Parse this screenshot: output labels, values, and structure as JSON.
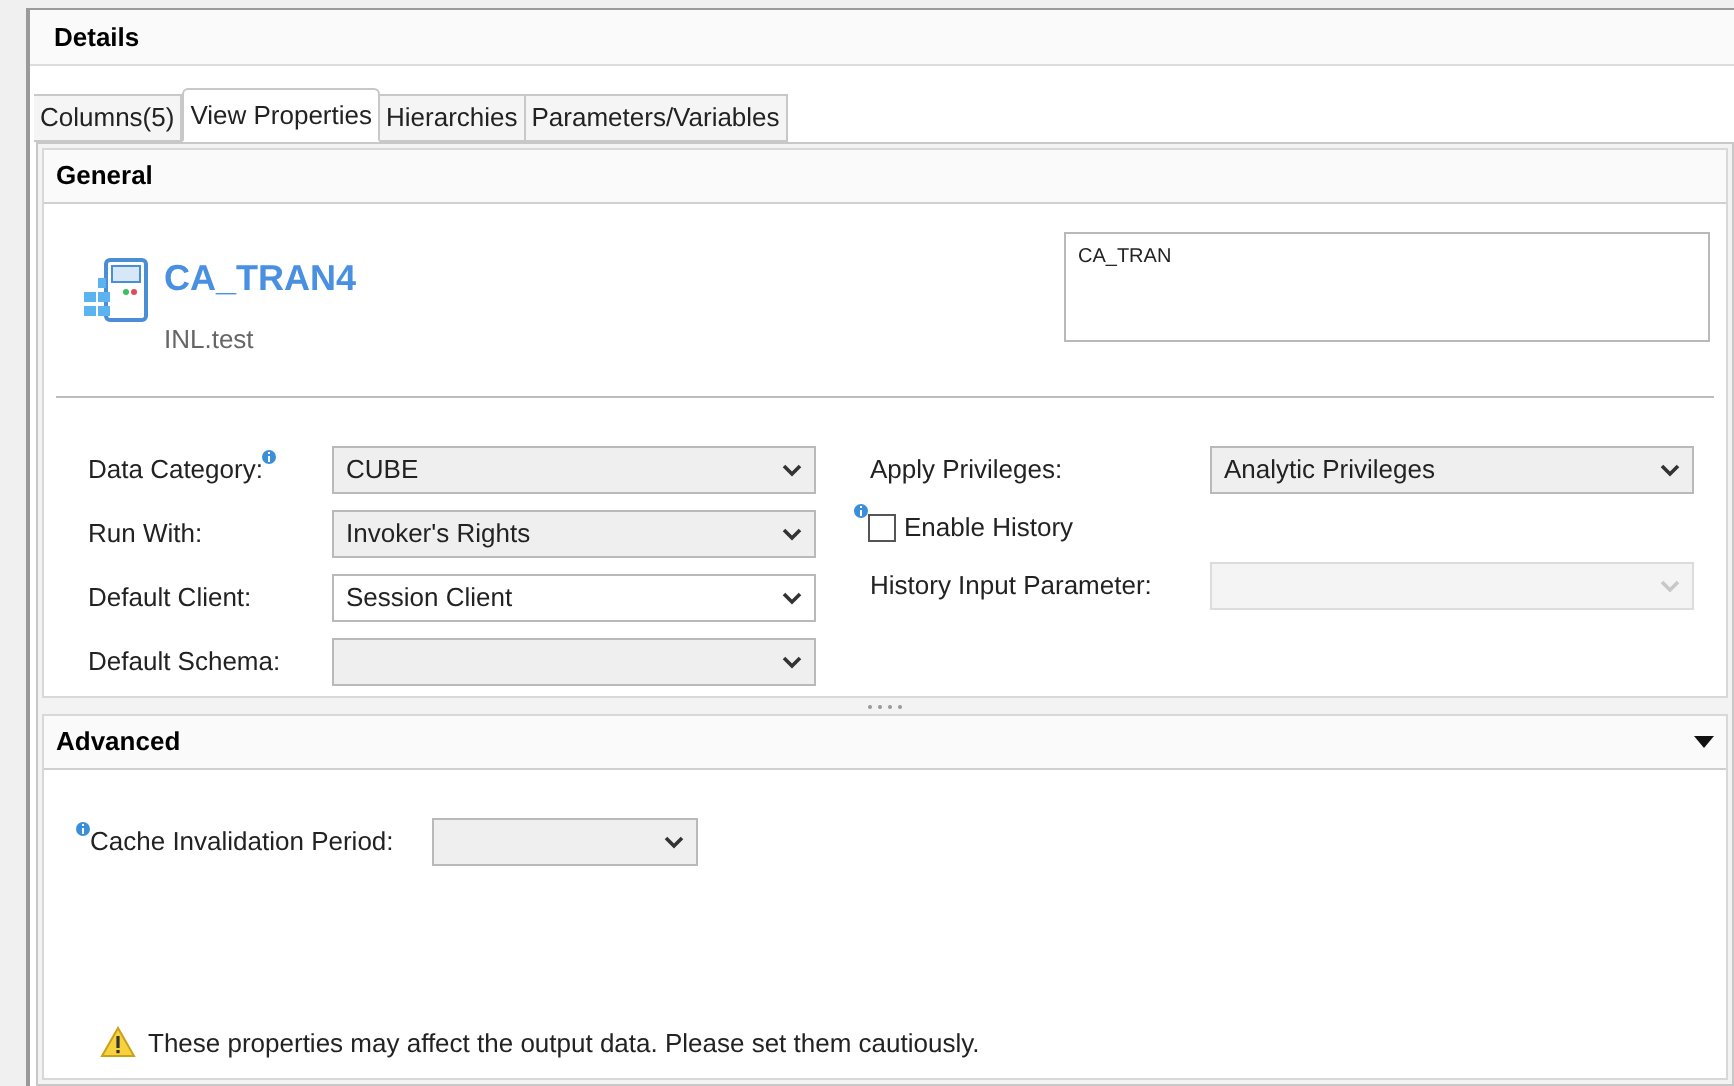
{
  "panel": {
    "title": "Details"
  },
  "tabs": [
    {
      "label": "Columns(5)",
      "selected": false
    },
    {
      "label": "View Properties",
      "selected": true
    },
    {
      "label": "Hierarchies",
      "selected": false
    },
    {
      "label": "Parameters/Variables",
      "selected": false
    }
  ],
  "general": {
    "title": "General",
    "object_name": "CA_TRAN4",
    "package": "INL.test",
    "description": "CA_TRAN",
    "left_fields": [
      {
        "label": "Data Category:",
        "value": "CUBE",
        "kind": "dropdown",
        "disabled": false,
        "info_after": true
      },
      {
        "label": "Run With:",
        "value": "Invoker's Rights",
        "kind": "dropdown",
        "disabled": false
      },
      {
        "label": "Default Client:",
        "value": "Session Client",
        "kind": "combo",
        "disabled": false
      },
      {
        "label": "Default Schema:",
        "kind": "dropdown",
        "disabled": false
      }
    ],
    "right_fields": [
      {
        "label": "Apply Privileges:",
        "value": "Analytic Privileges",
        "kind": "dropdown",
        "disabled": false
      },
      {
        "label": "Enable History",
        "kind": "checkbox",
        "checked": false,
        "info_before": true
      },
      {
        "label": "History Input Parameter:",
        "kind": "dropdown",
        "disabled": true
      }
    ]
  },
  "advanced": {
    "title": "Advanced",
    "expanded": true,
    "fields": [
      {
        "label": "Cache Invalidation Period:",
        "kind": "dropdown",
        "disabled": false,
        "info_before": true
      }
    ],
    "warning": "These properties may affect the output data. Please set them cautiously."
  }
}
